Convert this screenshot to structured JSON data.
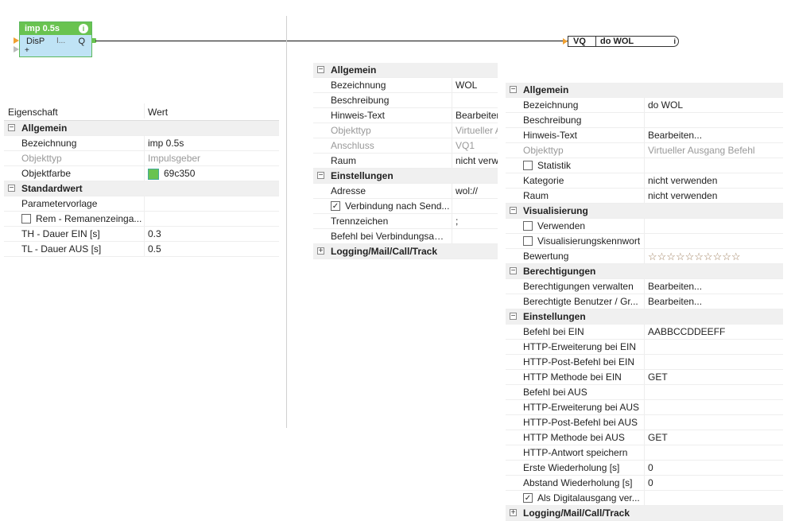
{
  "block": {
    "title": "imp 0.5s",
    "info_icon": "info-icon",
    "input": "DisP",
    "mid": "I...",
    "output": "Q",
    "plus": "+"
  },
  "out_block": {
    "vq": "VQ",
    "name": "do WOL",
    "info": "i"
  },
  "left_panel": {
    "col_property": "Eigenschaft",
    "col_value": "Wert",
    "rows": [
      {
        "type": "cat",
        "key": "Allgemein",
        "toggle": "⊟"
      },
      {
        "type": "prop",
        "key": "Bezeichnung",
        "value": "imp 0.5s"
      },
      {
        "type": "prop",
        "key": "Objekttyp",
        "value": "Impulsgeber",
        "dim": true
      },
      {
        "type": "prop",
        "key": "Objektfarbe",
        "value": "69c350",
        "swatch": "#69c350"
      },
      {
        "type": "cat",
        "key": "Standardwert",
        "toggle": "⊟"
      },
      {
        "type": "prop",
        "key": "Parametervorlage",
        "value": ""
      },
      {
        "type": "check",
        "key": "Rem - Remanenzeinga...",
        "checked": false
      },
      {
        "type": "prop",
        "key": "TH - Dauer EIN [s]",
        "value": "0.3"
      },
      {
        "type": "prop",
        "key": "TL - Dauer AUS [s]",
        "value": "0.5"
      }
    ]
  },
  "mid_panel": {
    "rows": [
      {
        "type": "cat",
        "key": "Allgemein",
        "toggle": "⊟"
      },
      {
        "type": "prop",
        "key": "Bezeichnung",
        "value": "WOL"
      },
      {
        "type": "prop",
        "key": "Beschreibung",
        "value": ""
      },
      {
        "type": "prop",
        "key": "Hinweis-Text",
        "value": "Bearbeiten"
      },
      {
        "type": "prop",
        "key": "Objekttyp",
        "value": "Virtueller A",
        "dim": true
      },
      {
        "type": "prop",
        "key": "Anschluss",
        "value": "VQ1",
        "dim": true
      },
      {
        "type": "prop",
        "key": "Raum",
        "value": "nicht verw"
      },
      {
        "type": "cat",
        "key": "Einstellungen",
        "toggle": "⊟"
      },
      {
        "type": "prop",
        "key": "Adresse",
        "value": "wol://"
      },
      {
        "type": "check",
        "key": "Verbindung nach Send...",
        "checked": true
      },
      {
        "type": "prop",
        "key": "Trennzeichen",
        "value": ";"
      },
      {
        "type": "prop",
        "key": "Befehl bei Verbindungsauf...",
        "value": ""
      },
      {
        "type": "cat",
        "key": "Logging/Mail/Call/Track",
        "toggle": "⊞"
      }
    ]
  },
  "right_panel": {
    "rows": [
      {
        "type": "cat",
        "key": "Allgemein",
        "toggle": "⊟"
      },
      {
        "type": "prop",
        "key": "Bezeichnung",
        "value": "do WOL"
      },
      {
        "type": "prop",
        "key": "Beschreibung",
        "value": ""
      },
      {
        "type": "prop",
        "key": "Hinweis-Text",
        "value": "Bearbeiten..."
      },
      {
        "type": "prop",
        "key": "Objekttyp",
        "value": "Virtueller Ausgang Befehl",
        "dim": true
      },
      {
        "type": "check",
        "key": "Statistik",
        "checked": false
      },
      {
        "type": "prop",
        "key": "Kategorie",
        "value": "nicht verwenden"
      },
      {
        "type": "prop",
        "key": "Raum",
        "value": "nicht verwenden"
      },
      {
        "type": "cat",
        "key": "Visualisierung",
        "toggle": "⊟"
      },
      {
        "type": "check",
        "key": "Verwenden",
        "checked": false
      },
      {
        "type": "check",
        "key": "Visualisierungskennwort",
        "checked": false
      },
      {
        "type": "prop",
        "key": "Bewertung",
        "value": "☆☆☆☆☆☆☆☆☆☆",
        "stars": true
      },
      {
        "type": "cat",
        "key": "Berechtigungen",
        "toggle": "⊟"
      },
      {
        "type": "prop",
        "key": "Berechtigungen verwalten",
        "value": "Bearbeiten..."
      },
      {
        "type": "prop",
        "key": "Berechtigte Benutzer / Gr...",
        "value": "Bearbeiten..."
      },
      {
        "type": "cat",
        "key": "Einstellungen",
        "toggle": "⊟"
      },
      {
        "type": "prop",
        "key": "Befehl bei EIN",
        "value": "AABBCCDDEEFF"
      },
      {
        "type": "prop",
        "key": "HTTP-Erweiterung bei EIN",
        "value": ""
      },
      {
        "type": "prop",
        "key": "HTTP-Post-Befehl bei EIN",
        "value": ""
      },
      {
        "type": "prop",
        "key": "HTTP Methode bei EIN",
        "value": "GET"
      },
      {
        "type": "prop",
        "key": "Befehl bei AUS",
        "value": ""
      },
      {
        "type": "prop",
        "key": "HTTP-Erweiterung bei AUS",
        "value": ""
      },
      {
        "type": "prop",
        "key": "HTTP-Post-Befehl bei AUS",
        "value": ""
      },
      {
        "type": "prop",
        "key": "HTTP Methode bei AUS",
        "value": "GET"
      },
      {
        "type": "prop",
        "key": "HTTP-Antwort speichern",
        "value": ""
      },
      {
        "type": "prop",
        "key": "Erste Wiederholung [s]",
        "value": "0"
      },
      {
        "type": "prop",
        "key": "Abstand Wiederholung [s]",
        "value": "0"
      },
      {
        "type": "check",
        "key": "Als Digitalausgang ver...",
        "checked": true
      },
      {
        "type": "cat",
        "key": "Logging/Mail/Call/Track",
        "toggle": "⊞"
      }
    ]
  }
}
